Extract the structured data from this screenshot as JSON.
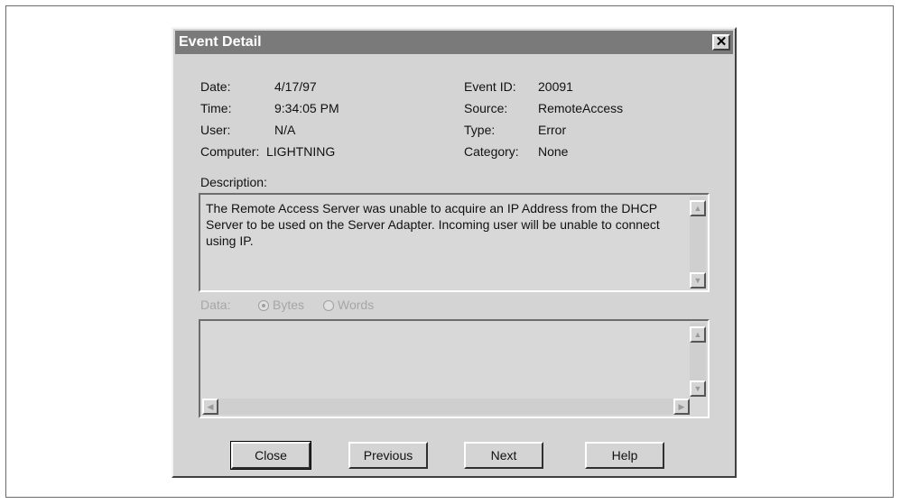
{
  "window": {
    "title": "Event Detail",
    "close_glyph": "✕"
  },
  "fields": {
    "date": {
      "label": "Date:",
      "value": "4/17/97"
    },
    "time": {
      "label": "Time:",
      "value": "9:34:05 PM"
    },
    "user": {
      "label": "User:",
      "value": "N/A"
    },
    "computer": {
      "label": "Computer:",
      "value": "LIGHTNING"
    },
    "event_id": {
      "label": "Event ID:",
      "value": "20091"
    },
    "source": {
      "label": "Source:",
      "value": "RemoteAccess"
    },
    "type": {
      "label": "Type:",
      "value": "Error"
    },
    "category": {
      "label": "Category:",
      "value": "None"
    }
  },
  "description": {
    "label": "Description:",
    "text": "The Remote Access Server was unable to acquire an IP Address from the DHCP Server to be used on the Server Adapter. Incoming user will be unable to connect using IP."
  },
  "data_section": {
    "label": "Data:",
    "options": [
      "Bytes",
      "Words"
    ],
    "selected": "Bytes"
  },
  "buttons": {
    "close": "Close",
    "previous": "Previous",
    "next": "Next",
    "help": "Help"
  },
  "icons": {
    "scroll_up": "up-arrow-icon",
    "scroll_down": "down-arrow-icon",
    "scroll_left": "left-arrow-icon",
    "scroll_right": "right-arrow-icon"
  }
}
